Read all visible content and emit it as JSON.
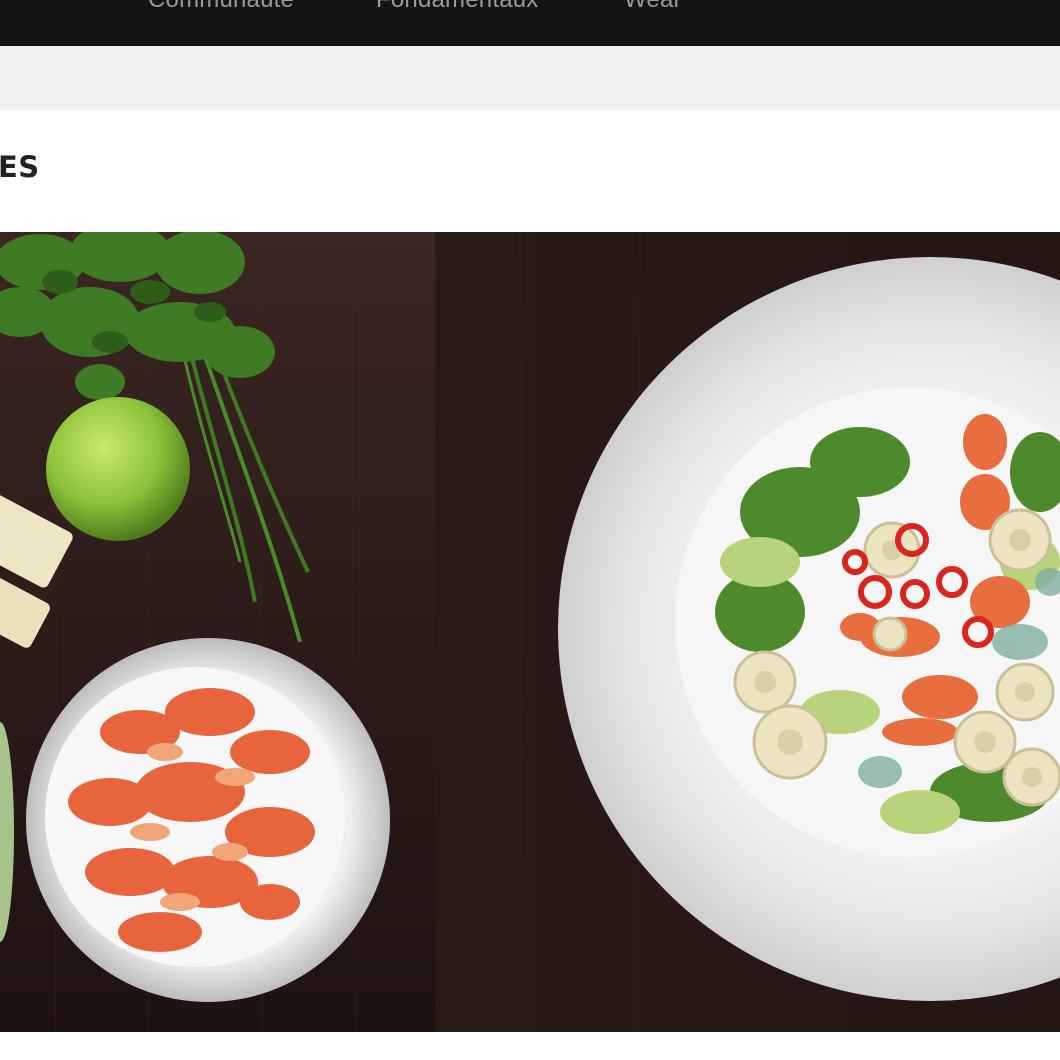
{
  "nav": {
    "items": [
      {
        "label": "Communauté"
      },
      {
        "label": "Fondamentaux"
      },
      {
        "label": "Wear"
      }
    ]
  },
  "page": {
    "heading": "ES"
  },
  "photo": {
    "subject": "salad-with-crayfish-photo"
  }
}
